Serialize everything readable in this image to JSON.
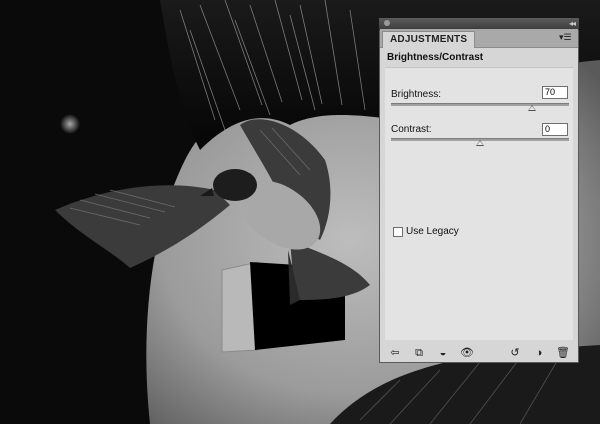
{
  "panel": {
    "tab_label": "ADJUSTMENTS",
    "title": "Brightness/Contrast"
  },
  "brightness": {
    "label": "Brightness:",
    "value": "70",
    "slider_fraction": 0.79
  },
  "contrast": {
    "label": "Contrast:",
    "value": "0",
    "slider_fraction": 0.5
  },
  "use_legacy": {
    "label": "Use Legacy",
    "checked": false
  },
  "icons": {
    "panel_menu": "panel-menu-icon",
    "back": "back-arrow-icon",
    "clip": "clip-to-layer-icon",
    "visibility_toggle": "visibility-toggle-icon",
    "eye": "eye-icon",
    "view_previous": "view-previous-state-icon",
    "reset": "reset-icon",
    "trash": "trash-icon"
  },
  "colors": {
    "panel_bg": "#d6d6d6",
    "panel_body": "#e3e3e3",
    "titlebar": "#4a4a4a"
  }
}
